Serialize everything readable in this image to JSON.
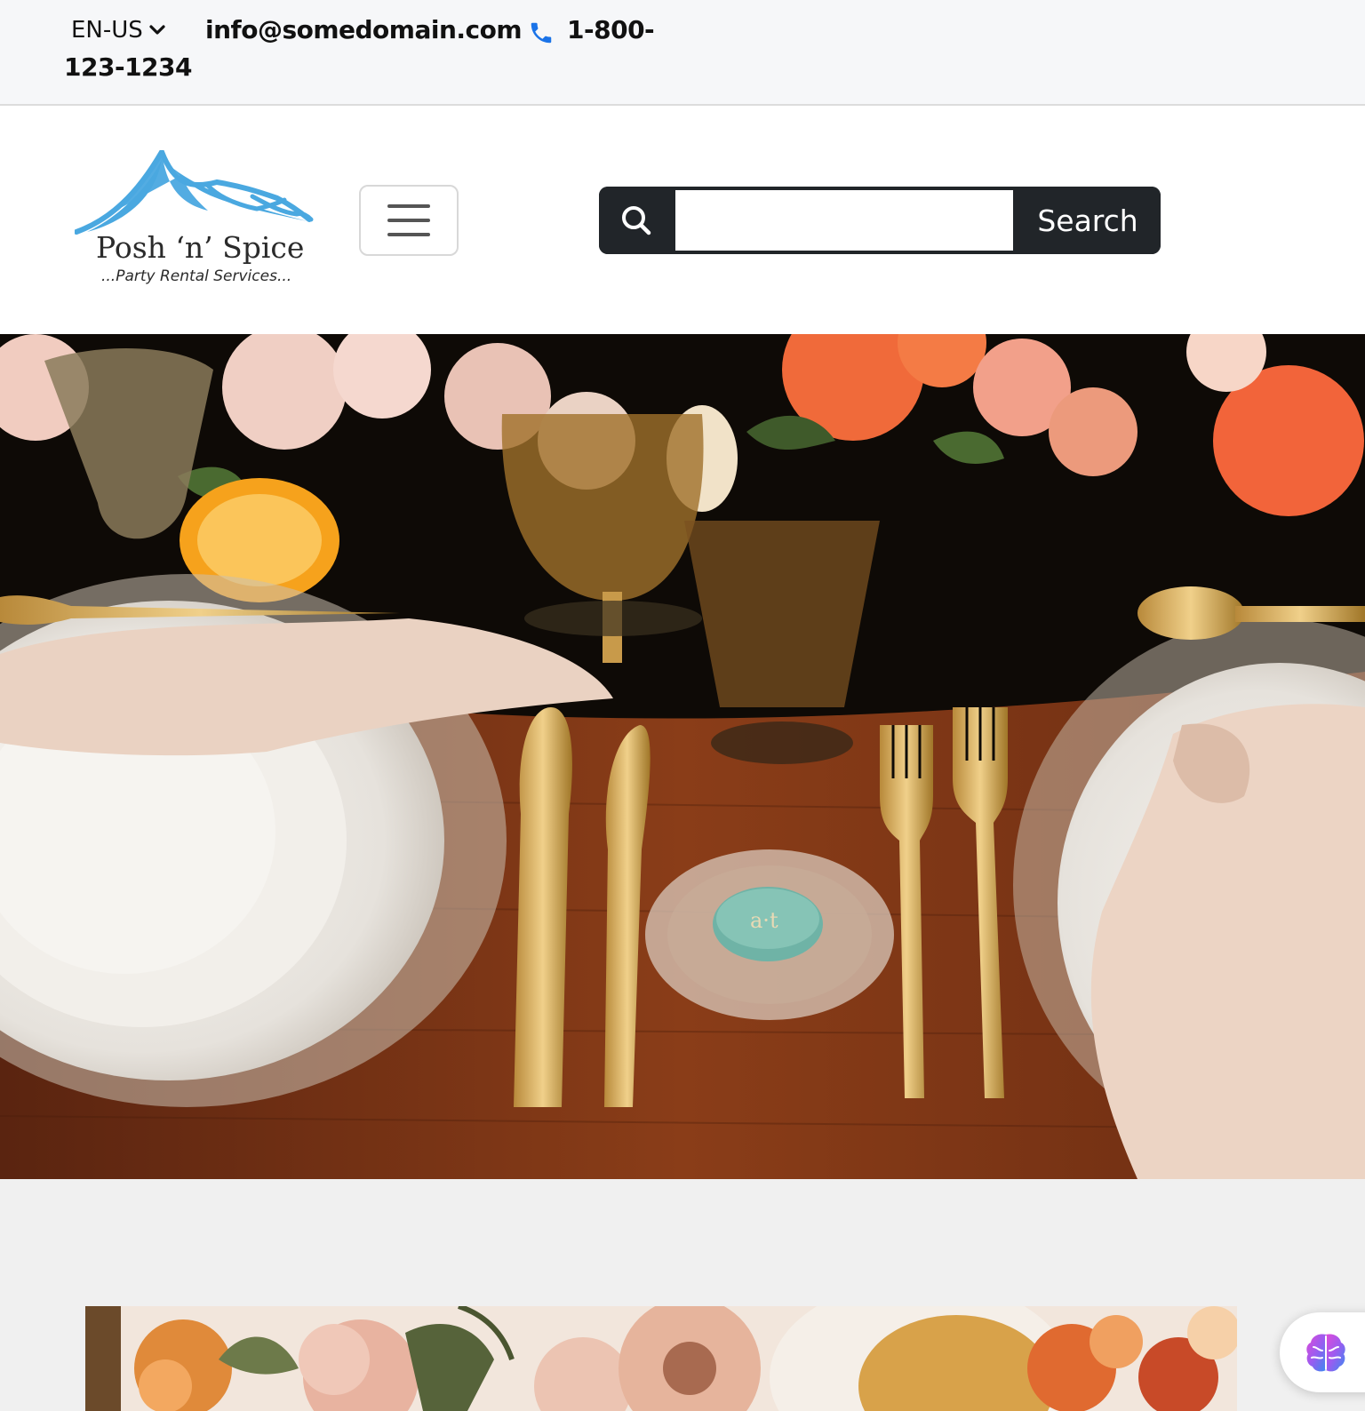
{
  "topbar": {
    "language": "EN-US",
    "email": "info@somedomain.com",
    "phone_line1": "1-800-",
    "phone_line2": "123-1234"
  },
  "header": {
    "logo_name": "Posh ‘n’ Spice",
    "logo_tagline": "...Party Rental Services...",
    "search": {
      "value": "",
      "placeholder": "",
      "button_label": "Search"
    }
  },
  "icons": {
    "language_dropdown": "chevron-down-icon",
    "phone": "phone-icon",
    "search": "search-icon",
    "menu": "hamburger-menu-icon",
    "assistant": "brain-icon"
  },
  "colors": {
    "brand_blue": "#4aa8e0",
    "dark": "#212529",
    "phone_blue": "#1a73e8",
    "topbar_bg": "#f6f7f9",
    "page_bg": "#f0f0f0"
  }
}
